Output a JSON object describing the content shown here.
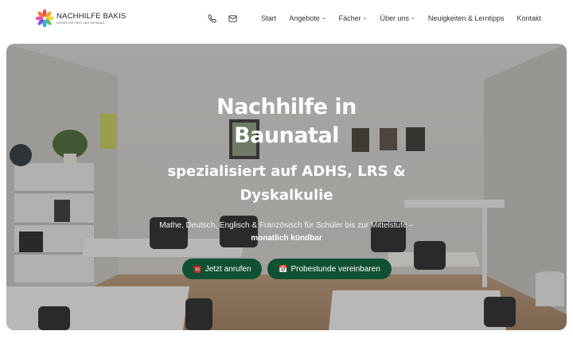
{
  "brand": {
    "name": "NACHHILFE BAKIS",
    "tagline": "Lernen mit Herz und Verstand",
    "colors": [
      "#e94b5b",
      "#f5a623",
      "#f8d13a",
      "#5bbf5e",
      "#3ba9d9",
      "#7b5bd6"
    ]
  },
  "nav": {
    "phone_icon": "phone-icon",
    "mail_icon": "mail-icon",
    "items": [
      {
        "label": "Start",
        "dropdown": false
      },
      {
        "label": "Angebote",
        "dropdown": true
      },
      {
        "label": "Fächer",
        "dropdown": true
      },
      {
        "label": "Über uns",
        "dropdown": true
      },
      {
        "label": "Neuigkeiten & Lerntipps",
        "dropdown": false
      },
      {
        "label": "Kontakt",
        "dropdown": false
      }
    ]
  },
  "hero": {
    "title": "Nachhilfe in Baunatal",
    "subtitle": "spezialisiert auf ADHS, LRS & Dyskalkulie",
    "description": "Mathe, Deutsch, Englisch & Französisch für Schüler bis zur Mittelstufe – ",
    "description_bold": "monatlich kündbar",
    "call_icon": "☎️",
    "call_label": "Jetzt anrufen",
    "trial_icon": "📅",
    "trial_label": "Probestunde vereinbaren",
    "button_color": "#0f5132"
  }
}
